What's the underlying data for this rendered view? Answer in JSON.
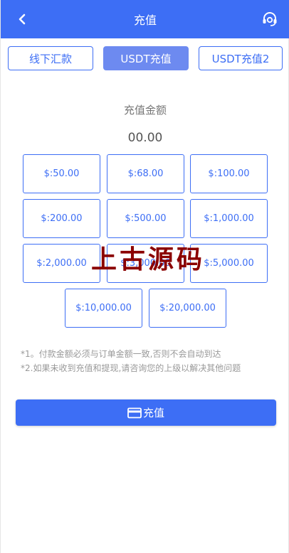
{
  "header": {
    "title": "充值",
    "back_icon": "chevron-left-icon",
    "service_icon": "headset-icon"
  },
  "tabs": [
    {
      "label": "线下汇款",
      "active": false
    },
    {
      "label": "USDT充值",
      "active": true
    },
    {
      "label": "USDT充值2",
      "active": false
    }
  ],
  "amount": {
    "label": "充值金额",
    "value": "00.00"
  },
  "amount_options": [
    "$:50.00",
    "$:68.00",
    "$:100.00",
    "$:200.00",
    "$:500.00",
    "$:1,000.00",
    "$:2,000.00",
    "$:3,000.00",
    "$:5,000.00",
    "$:10,000.00",
    "$:20,000.00"
  ],
  "watermark": "上古源码",
  "notes": [
    "*1。付款金额必须与订单金额一致,否则不会自动到达",
    "*2.如果未收到充值和提现,请咨询您的上级以解决其他问题"
  ],
  "submit": {
    "label": "充值",
    "icon": "card-icon"
  },
  "colors": {
    "primary": "#3d6ef5",
    "tab_active": "#6d8af0",
    "watermark": "#8b0000"
  }
}
